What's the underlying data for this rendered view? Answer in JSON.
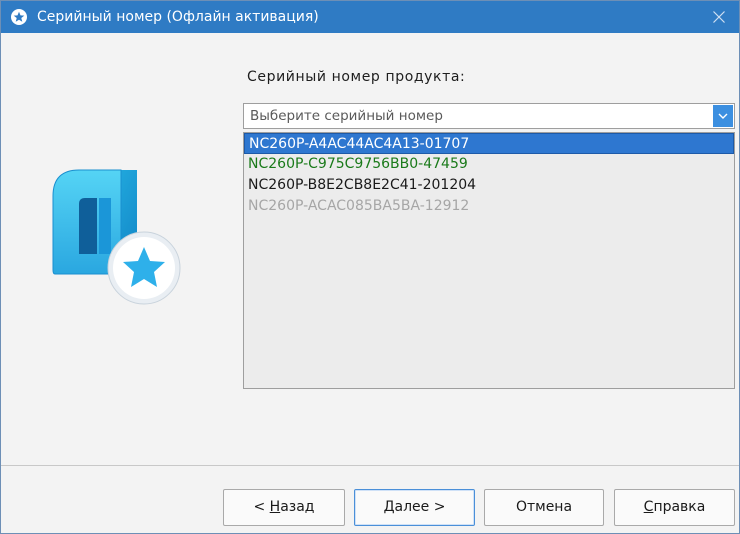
{
  "window": {
    "title": "Серийный номер (Офлайн активация)",
    "title_icon": "star-icon",
    "close_icon": "close-icon",
    "titlebar_color": "#2f7bc4"
  },
  "main": {
    "product_label": "Серийный номер продукта:",
    "combo": {
      "placeholder": "Выберите серийный номер",
      "arrow_icon": "chevron-down-icon"
    },
    "serial_list": [
      {
        "value": "NC260P-A4AC44AC4A13-01707",
        "state": "selected"
      },
      {
        "value": "NC260P-C975C9756BB0-47459",
        "state": "valid"
      },
      {
        "value": "NC260P-B8E2CB8E2C41-201204",
        "state": "normal"
      },
      {
        "value": "NC260P-ACAC085BA5BA-12912",
        "state": "disabled"
      }
    ],
    "logo_icon": "app-logo-star-icon"
  },
  "footer": {
    "back": {
      "prefix": "< ",
      "mnemonic": "Н",
      "rest": "азад"
    },
    "next": {
      "mnemonic": "Д",
      "rest": "алее >"
    },
    "cancel": {
      "label": "Отмена"
    },
    "help": {
      "mnemonic": "С",
      "rest": "правка"
    }
  },
  "colors": {
    "selected_row": "#2e77d0",
    "valid_text": "#1a7a1a",
    "disabled_text": "#a6a6a6",
    "accent": "#3c8fe0"
  }
}
